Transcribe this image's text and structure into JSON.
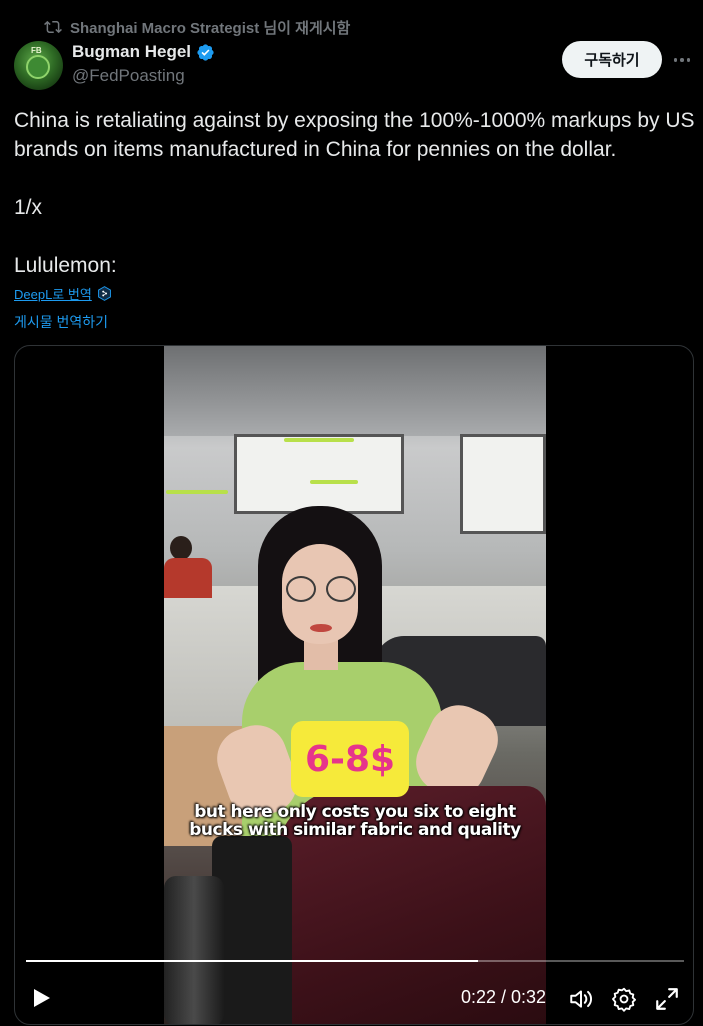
{
  "repost": {
    "text": "Shanghai Macro Strategist 님이 재게시함",
    "icon": "repost-icon"
  },
  "author": {
    "name": "Bugman Hegel",
    "handle": "@FedPoasting",
    "verified": true,
    "avatar_badge": "FB"
  },
  "actions": {
    "subscribe_label": "구독하기",
    "more_icon": "more-horizontal-icon"
  },
  "tweet": {
    "text": "China is retaliating against by exposing the 100%-1000% markups by US brands on items manufactured in China for pennies on the dollar.\n\n1/x\n\nLululemon:"
  },
  "translate": {
    "deepl_label": "DeepL로 번역",
    "post_label": "게시물 번역하기"
  },
  "video": {
    "price_overlay": "6-8$",
    "caption": "but here only costs you six to eight\nbucks with similar fabric and quality",
    "current_time": "0:22",
    "duration": "0:32",
    "time_display": "0:22 / 0:32",
    "progress_fraction": 0.6875,
    "controls": [
      "play-icon",
      "volume-icon",
      "settings-icon",
      "fullscreen-icon"
    ]
  },
  "colors": {
    "background": "#000000",
    "text": "#e7e9ea",
    "secondary": "#71767b",
    "link": "#1d9bf0",
    "verified": "#1d9bf0",
    "price_tag": "#f6ea3a",
    "price_text": "#e6358b"
  }
}
